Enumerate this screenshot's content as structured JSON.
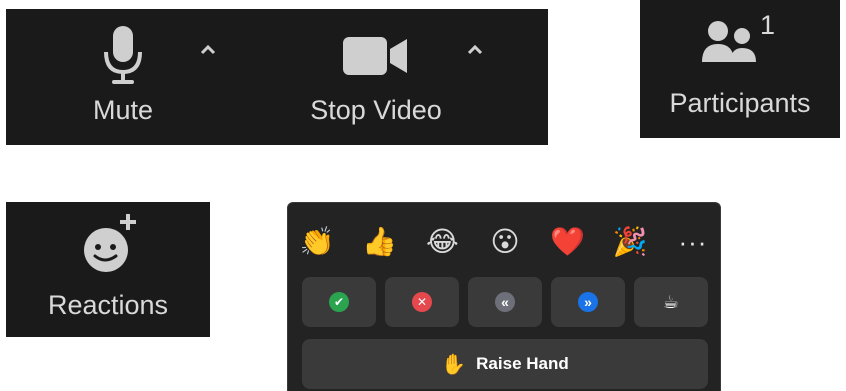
{
  "toolbar": {
    "mute_label": "Mute",
    "stop_video_label": "Stop Video",
    "participants_label": "Participants",
    "participants_count": "1",
    "reactions_label": "Reactions"
  },
  "reactions_popover": {
    "emojis": [
      {
        "glyph": "👏",
        "name": "clap"
      },
      {
        "glyph": "👍",
        "name": "thumbs-up"
      },
      {
        "glyph": "😂",
        "name": "tears-of-joy"
      },
      {
        "glyph": "😮",
        "name": "open-mouth"
      },
      {
        "glyph": "❤️",
        "name": "heart"
      },
      {
        "glyph": "🎉",
        "name": "tada"
      }
    ],
    "more_label": "···",
    "feedback": [
      {
        "name": "yes",
        "symbol": "✔",
        "color": "#2aa44f"
      },
      {
        "name": "no",
        "symbol": "✕",
        "color": "#e5484d"
      },
      {
        "name": "slow-down",
        "symbol": "«",
        "color": "#6e7079"
      },
      {
        "name": "speed-up",
        "symbol": "»",
        "color": "#1a73e8"
      },
      {
        "name": "coffee",
        "symbol": "☕",
        "color": ""
      }
    ],
    "raise_hand_glyph": "✋",
    "raise_hand_label": "Raise Hand"
  },
  "colors": {
    "toolbar_bg": "#1a1a1a",
    "popover_bg": "#232323",
    "button_bg": "#3a3a3a",
    "text": "#d9d9d9"
  }
}
